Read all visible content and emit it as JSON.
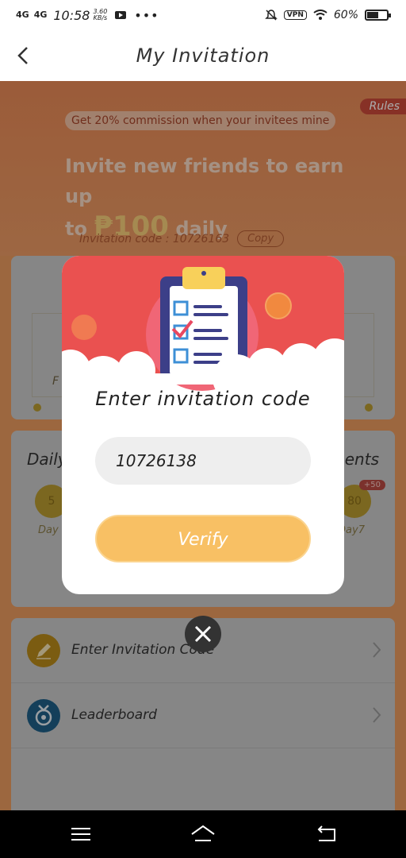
{
  "status_bar": {
    "network1": "4G",
    "network2": "4G",
    "time": "10:58",
    "speed_value": "3.60",
    "speed_unit": "KB/s",
    "dots": "•••",
    "vpn": "VPN",
    "battery": "60%",
    "battery_level": 0.6
  },
  "nav": {
    "title": "My Invitation"
  },
  "banner": {
    "rules": "Rules",
    "commission": "Get 20% commission when your invitees mine",
    "headline_line1": "Invite new friends to earn up",
    "headline_prefix": "to ",
    "headline_amount": "₱100",
    "headline_suffix": " daily",
    "code_label": "Invitation code : 10726163",
    "copy": "Copy"
  },
  "background": {
    "daily_left": "Daily",
    "daily_right": "ents",
    "coin_left": "5",
    "coin_right": "80",
    "day_left": "Day",
    "day_right": "Day7",
    "bonus": "+50",
    "card1_text": "F"
  },
  "menu": {
    "items": [
      {
        "label": "Enter Invitation Code",
        "icon": "pencil-icon",
        "color": "#b8891a"
      },
      {
        "label": "Leaderboard",
        "icon": "medal-icon",
        "color": "#1f5f86"
      }
    ]
  },
  "modal": {
    "title": "Enter invitation code",
    "input_value": "10726138",
    "verify": "Verify",
    "accent": "#ea5150",
    "button_color": "#f8c064"
  }
}
